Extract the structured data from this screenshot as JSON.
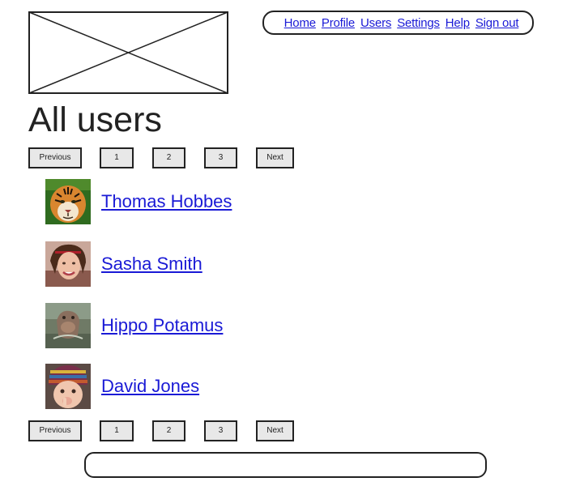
{
  "nav": {
    "items": [
      {
        "label": "Home"
      },
      {
        "label": "Profile"
      },
      {
        "label": "Users"
      },
      {
        "label": "Settings"
      },
      {
        "label": "Help"
      },
      {
        "label": "Sign out"
      }
    ]
  },
  "page": {
    "title": "All users"
  },
  "pagination": {
    "previous": "Previous",
    "pages": [
      "1",
      "2",
      "3"
    ],
    "next": "Next"
  },
  "users": [
    {
      "name": "Thomas Hobbes",
      "avatar": "tiger-photo"
    },
    {
      "name": "Sasha Smith",
      "avatar": "woman-portrait-photo"
    },
    {
      "name": "Hippo Potamus",
      "avatar": "hippo-photo"
    },
    {
      "name": "David Jones",
      "avatar": "child-photo"
    }
  ],
  "colors": {
    "link": "#1a1ad6",
    "border": "#222222",
    "button_bg": "#e8e8e8"
  }
}
